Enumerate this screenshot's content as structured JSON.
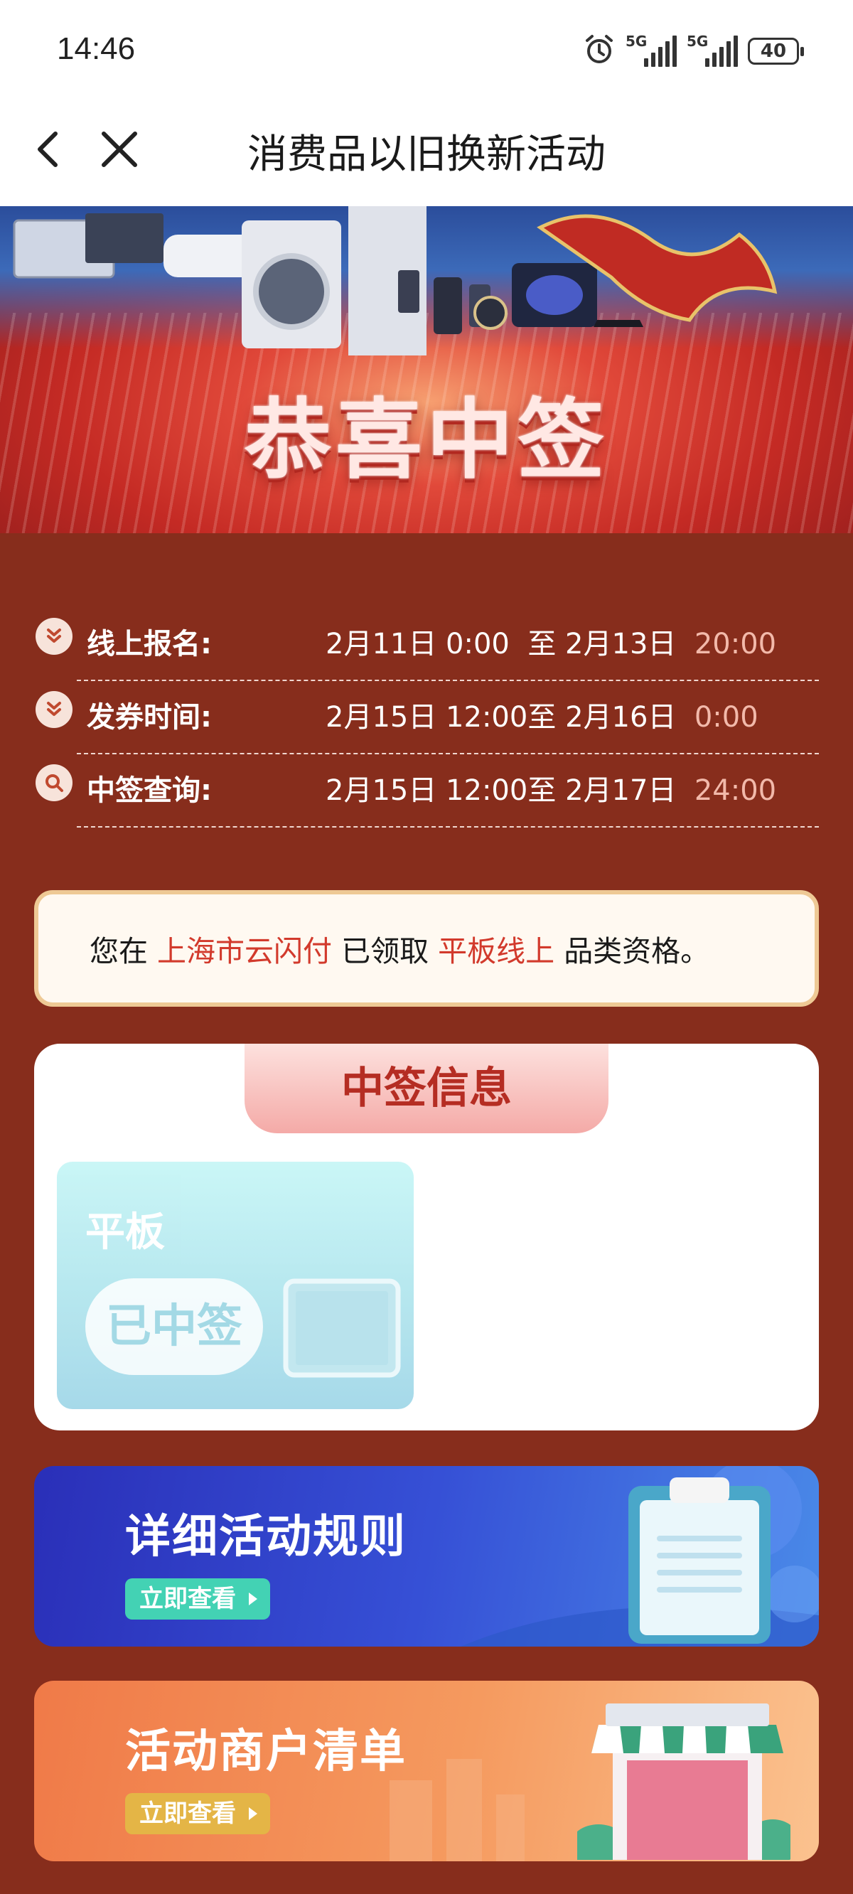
{
  "status_bar": {
    "time": "14:46",
    "signal_1": "5G",
    "signal_2": "5G",
    "battery": "40",
    "icons": [
      "alarm-icon",
      "signal-icon",
      "signal-icon",
      "battery-icon"
    ]
  },
  "nav": {
    "title": "消费品以旧换新活动",
    "back_icon": "chevron-left-icon",
    "close_icon": "close-icon"
  },
  "banner": {
    "headline": "恭喜中签"
  },
  "schedule": [
    {
      "label": "线上报名:",
      "start": "2月11日  0:00",
      "sep": "至",
      "end_date": "2月13日",
      "end_time": "20:00",
      "icon": "double-chevron-down-icon"
    },
    {
      "label": "发券时间:",
      "start": "2月15日  12:00",
      "sep": "至",
      "end_date": "2月16日",
      "end_time": "0:00",
      "icon": "double-chevron-down-icon"
    },
    {
      "label": "中签查询:",
      "start": "2月15日  12:00",
      "sep": "至",
      "end_date": "2月17日",
      "end_time": "24:00",
      "icon": "search-icon"
    }
  ],
  "notice": {
    "prefix": "您在",
    "platform": "上海市云闪付",
    "middle": "已领取",
    "category": "平板线上",
    "suffix": "品类资格。"
  },
  "winning_info": {
    "title": "中签信息",
    "prizes": [
      {
        "name": "平板",
        "status": "已中签",
        "icon": "tablet-icon"
      }
    ]
  },
  "promos": {
    "rules": {
      "title": "详细活动规则",
      "button": "立即查看",
      "icon": "clipboard-icon"
    },
    "merchants": {
      "title": "活动商户清单",
      "button": "立即查看",
      "icon": "storefront-icon"
    }
  },
  "colors": {
    "page_bg": "#872d1c",
    "highlight": "#d23a2c",
    "notice_border": "#eec995",
    "rules_bg": "#3650d6",
    "merchants_bg": "#f59a5f"
  }
}
